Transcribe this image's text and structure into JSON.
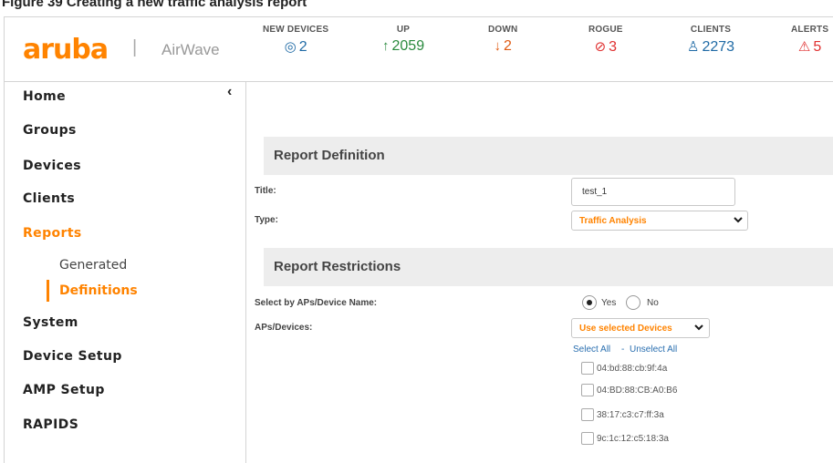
{
  "figure_caption": "Figure 39 Creating a new traffic analysis report",
  "header": {
    "logo": "aruba",
    "separator": "|",
    "product": "AirWave",
    "stats": [
      {
        "label": "NEW DEVICES",
        "icon": "new-devices-icon",
        "glyph": "◎",
        "value": "2",
        "color": "#1f6aa5"
      },
      {
        "label": "UP",
        "icon": "arrow-up-icon",
        "glyph": "↑",
        "value": "2059",
        "color": "#2a8a3e"
      },
      {
        "label": "DOWN",
        "icon": "arrow-down-icon",
        "glyph": "↓",
        "value": "2",
        "color": "#e05a12"
      },
      {
        "label": "ROGUE",
        "icon": "rogue-icon",
        "glyph": "⊘",
        "value": "3",
        "color": "#e03030"
      },
      {
        "label": "CLIENTS",
        "icon": "clients-icon",
        "glyph": "♙",
        "value": "2273",
        "color": "#1f6aa5"
      },
      {
        "label": "ALERTS",
        "icon": "alert-icon",
        "glyph": "⚠",
        "value": "5",
        "color": "#e03030"
      }
    ]
  },
  "sidebar": {
    "collapse_glyph": "‹",
    "items": [
      {
        "label": "Home"
      },
      {
        "label": "Groups"
      },
      {
        "label": "Devices"
      },
      {
        "label": "Clients"
      },
      {
        "label": "Reports",
        "active": true
      },
      {
        "label": "System"
      },
      {
        "label": "Device Setup"
      },
      {
        "label": "AMP Setup"
      },
      {
        "label": "RAPIDS"
      }
    ],
    "reports_sub": [
      {
        "label": "Generated"
      },
      {
        "label": "Definitions",
        "active": true
      }
    ]
  },
  "report_definition": {
    "heading": "Report Definition",
    "title_label": "Title:",
    "title_value": "test_1",
    "type_label": "Type:",
    "type_value": "Traffic Analysis"
  },
  "report_restrictions": {
    "heading": "Report Restrictions",
    "select_by_label": "Select by APs/Device Name:",
    "yes_label": "Yes",
    "no_label": "No",
    "selected": "Yes",
    "devices_label": "APs/Devices:",
    "devices_select": "Use selected Devices",
    "select_all": "Select All",
    "link_separator": "-",
    "unselect_all": "Unselect All",
    "devices": [
      "04:bd:88:cb:9f:4a",
      "04:BD:88:CB:A0:B6",
      "38:17:c3:c7:ff:3a",
      "9c:1c:12:c5:18:3a"
    ]
  },
  "colors": {
    "accent": "#ff8300",
    "link": "#2a6fb0"
  }
}
